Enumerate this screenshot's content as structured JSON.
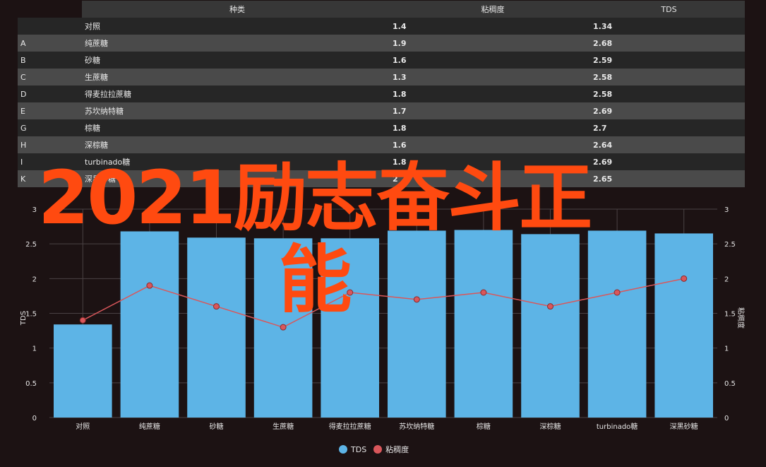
{
  "table": {
    "headers": [
      "",
      "种类",
      "粘稠度",
      "TDS"
    ],
    "rows": [
      {
        "idx": "",
        "name": "对照",
        "v": "1.4",
        "tds": "1.34"
      },
      {
        "idx": "A",
        "name": "纯蔗糖",
        "v": "1.9",
        "tds": "2.68"
      },
      {
        "idx": "B",
        "name": "砂糖",
        "v": "1.6",
        "tds": "2.59"
      },
      {
        "idx": "C",
        "name": "生蔗糖",
        "v": "1.3",
        "tds": "2.58"
      },
      {
        "idx": "D",
        "name": "得麦拉拉蔗糖",
        "v": "1.8",
        "tds": "2.58"
      },
      {
        "idx": "E",
        "name": "苏坎纳特糖",
        "v": "1.7",
        "tds": "2.69"
      },
      {
        "idx": "G",
        "name": "棕糖",
        "v": "1.8",
        "tds": "2.7"
      },
      {
        "idx": "H",
        "name": "深棕糖",
        "v": "1.6",
        "tds": "2.64"
      },
      {
        "idx": "I",
        "name": "turbinado糖",
        "v": "1.8",
        "tds": "2.69"
      },
      {
        "idx": "K",
        "name": "深黑砂糖",
        "v": "2",
        "tds": "2.65"
      }
    ]
  },
  "overlay": {
    "line1": "2021励志奋斗正",
    "line2": "能"
  },
  "chart_data": {
    "type": "bar",
    "categories": [
      "对照",
      "纯蔗糖",
      "砂糖",
      "生蔗糖",
      "得麦拉拉蔗糖",
      "苏坎纳特糖",
      "棕糖",
      "深棕糖",
      "turbinado糖",
      "深黑砂糖"
    ],
    "series": [
      {
        "name": "TDS",
        "type": "bar",
        "axis": "left",
        "color": "#5db4e6",
        "values": [
          1.34,
          2.68,
          2.59,
          2.58,
          2.58,
          2.69,
          2.7,
          2.64,
          2.69,
          2.65
        ]
      },
      {
        "name": "粘稠度",
        "type": "line",
        "axis": "right",
        "color": "#d9575b",
        "values": [
          1.4,
          1.9,
          1.6,
          1.3,
          1.8,
          1.7,
          1.8,
          1.6,
          1.8,
          2.0
        ]
      }
    ],
    "ylabel_left": "TDS",
    "ylabel_right": "粘稠度",
    "ylim_left": [
      0,
      3
    ],
    "ylim_right": [
      0,
      3
    ],
    "yticks": [
      "0",
      "0.5",
      "1",
      "1.5",
      "2",
      "2.5",
      "3"
    ],
    "grid": true,
    "legend": "bottom"
  },
  "colors": {
    "background": "#1c1213",
    "bar": "#5db4e6",
    "line": "#d9575b",
    "overlay_text": "#ff4a10"
  }
}
